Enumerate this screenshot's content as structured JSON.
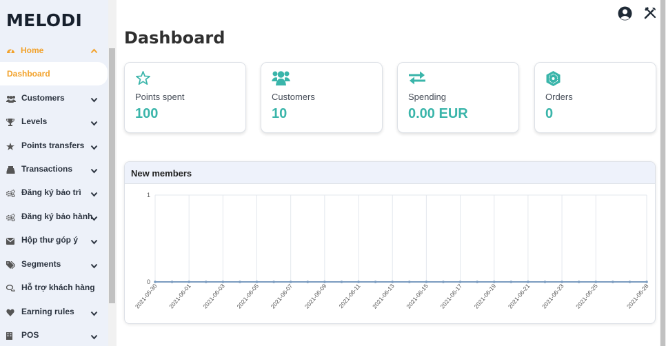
{
  "brand": "MELODI",
  "sidebar": {
    "home": {
      "label": "Home",
      "icon": "dashboard-gauge-icon"
    },
    "active": {
      "label": "Dashboard"
    },
    "items": [
      {
        "label": "Customers",
        "icon": "users-icon"
      },
      {
        "label": "Levels",
        "icon": "trophy-icon"
      },
      {
        "label": "Points transfers",
        "icon": "star-icon"
      },
      {
        "label": "Transactions",
        "icon": "register-icon"
      },
      {
        "label": "Đăng ký bảo trì",
        "icon": "gears-icon"
      },
      {
        "label": "Đăng ký bảo hành",
        "icon": "gears-icon"
      },
      {
        "label": "Hộp thư góp ý",
        "icon": "envelope-icon"
      },
      {
        "label": "Segments",
        "icon": "tags-icon"
      },
      {
        "label": "Hỗ trợ khách hàng",
        "icon": "chat-icon"
      },
      {
        "label": "Earning rules",
        "icon": "heart-icon"
      },
      {
        "label": "POS",
        "icon": "building-icon"
      }
    ]
  },
  "header": {
    "user_icon": "user-circle-icon",
    "tools_icon": "tools-icon"
  },
  "page": {
    "title": "Dashboard"
  },
  "cards": [
    {
      "label": "Points spent",
      "value": "100",
      "icon": "star-outline-icon"
    },
    {
      "label": "Customers",
      "value": "10",
      "icon": "users-icon"
    },
    {
      "label": "Spending",
      "value": "0.00 EUR",
      "icon": "exchange-arrows-icon"
    },
    {
      "label": "Orders",
      "value": "0",
      "icon": "cube-icon"
    }
  ],
  "colors": {
    "accent": "#f2a22b",
    "teal": "#3ab5aa",
    "line": "#7a9bbf"
  },
  "chart_data": {
    "type": "line",
    "title": "New members",
    "xlabel": "",
    "ylabel": "",
    "ylim": [
      0,
      1
    ],
    "yticks": [
      "0",
      "1"
    ],
    "grid": true,
    "x": [
      "2021-05-30",
      "2021-05-31",
      "2021-06-01",
      "2021-06-02",
      "2021-06-03",
      "2021-06-04",
      "2021-06-05",
      "2021-06-06",
      "2021-06-07",
      "2021-06-08",
      "2021-06-09",
      "2021-06-10",
      "2021-06-11",
      "2021-06-12",
      "2021-06-13",
      "2021-06-14",
      "2021-06-15",
      "2021-06-16",
      "2021-06-17",
      "2021-06-18",
      "2021-06-19",
      "2021-06-20",
      "2021-06-21",
      "2021-06-22",
      "2021-06-23",
      "2021-06-24",
      "2021-06-25",
      "2021-06-26",
      "2021-06-27",
      "2021-06-28"
    ],
    "xtick_labels": [
      "2021-05-30",
      "2021-06-01",
      "2021-06-03",
      "2021-06-05",
      "2021-06-07",
      "2021-06-09",
      "2021-06-11",
      "2021-06-13",
      "2021-06-15",
      "2021-06-17",
      "2021-06-19",
      "2021-06-21",
      "2021-06-23",
      "2021-06-25",
      "2021-06-28"
    ],
    "series": [
      {
        "values": [
          0,
          0,
          0,
          0,
          0,
          0,
          0,
          0,
          0,
          0,
          0,
          0,
          0,
          0,
          0,
          0,
          0,
          0,
          0,
          0,
          0,
          0,
          0,
          0,
          0,
          0,
          0,
          0,
          0,
          0
        ]
      }
    ]
  }
}
